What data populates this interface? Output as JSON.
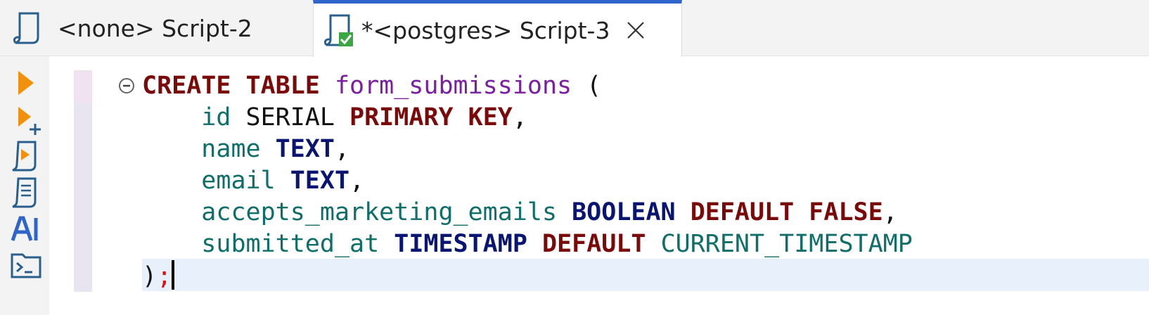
{
  "tabs": [
    {
      "label": "<none> Script-2",
      "active": false
    },
    {
      "label": "*<postgres> Script-3",
      "active": true
    }
  ],
  "toolbar": {
    "buttons": [
      "execute-statement",
      "execute-statement-new-tab",
      "execute-script",
      "explain-plan",
      "ai-assistant",
      "terminal"
    ]
  },
  "editor": {
    "lines": [
      {
        "indent": "",
        "tokens": [
          {
            "t": "CREATE",
            "c": "kw"
          },
          {
            "t": " ",
            "c": "plain"
          },
          {
            "t": "TABLE",
            "c": "kw"
          },
          {
            "t": " ",
            "c": "plain"
          },
          {
            "t": "form_submissions",
            "c": "tbl"
          },
          {
            "t": " (",
            "c": "plain"
          }
        ]
      },
      {
        "indent": "    ",
        "tokens": [
          {
            "t": "id",
            "c": "col"
          },
          {
            "t": " SERIAL ",
            "c": "plain"
          },
          {
            "t": "PRIMARY",
            "c": "kw"
          },
          {
            "t": " ",
            "c": "plain"
          },
          {
            "t": "KEY",
            "c": "kw"
          },
          {
            "t": ",",
            "c": "plain"
          }
        ]
      },
      {
        "indent": "    ",
        "tokens": [
          {
            "t": "name",
            "c": "col"
          },
          {
            "t": " ",
            "c": "plain"
          },
          {
            "t": "TEXT",
            "c": "ty"
          },
          {
            "t": ",",
            "c": "plain"
          }
        ]
      },
      {
        "indent": "    ",
        "tokens": [
          {
            "t": "email",
            "c": "col"
          },
          {
            "t": " ",
            "c": "plain"
          },
          {
            "t": "TEXT",
            "c": "ty"
          },
          {
            "t": ",",
            "c": "plain"
          }
        ]
      },
      {
        "indent": "    ",
        "tokens": [
          {
            "t": "accepts_marketing_emails",
            "c": "col"
          },
          {
            "t": " ",
            "c": "plain"
          },
          {
            "t": "BOOLEAN",
            "c": "ty"
          },
          {
            "t": " ",
            "c": "plain"
          },
          {
            "t": "DEFAULT",
            "c": "kw"
          },
          {
            "t": " ",
            "c": "plain"
          },
          {
            "t": "FALSE",
            "c": "kw"
          },
          {
            "t": ",",
            "c": "plain"
          }
        ]
      },
      {
        "indent": "    ",
        "tokens": [
          {
            "t": "submitted_at",
            "c": "col"
          },
          {
            "t": " ",
            "c": "plain"
          },
          {
            "t": "TIMESTAMP",
            "c": "ty"
          },
          {
            "t": " ",
            "c": "plain"
          },
          {
            "t": "DEFAULT",
            "c": "kw"
          },
          {
            "t": " ",
            "c": "plain"
          },
          {
            "t": "CURRENT_TIMESTAMP",
            "c": "col"
          }
        ]
      },
      {
        "indent": "",
        "tokens": [
          {
            "t": ")",
            "c": "plain"
          },
          {
            "t": ";",
            "c": "red"
          }
        ]
      }
    ]
  }
}
